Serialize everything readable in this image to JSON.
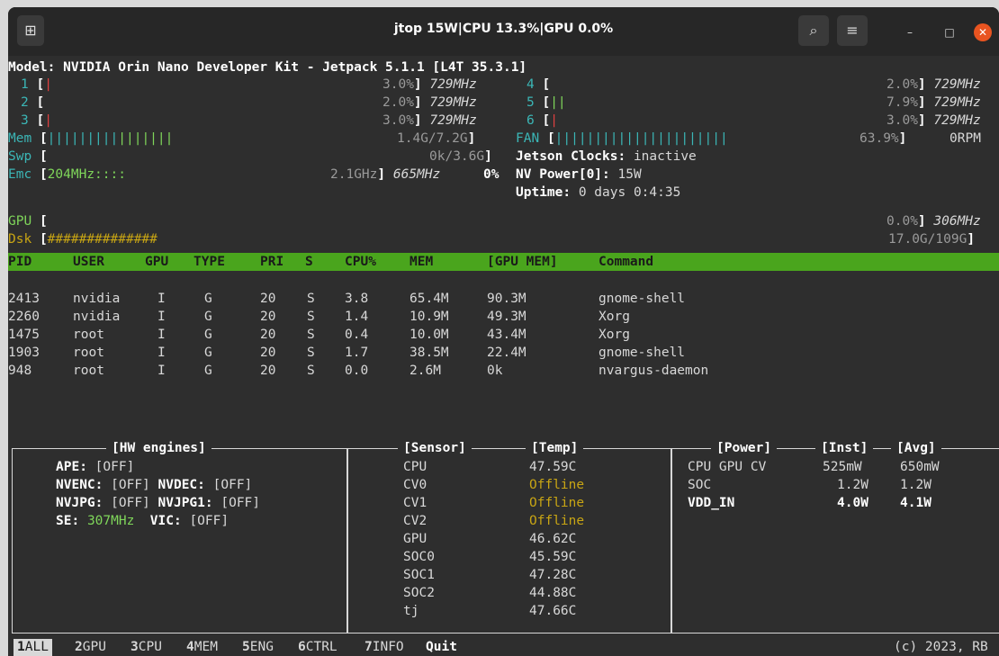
{
  "window": {
    "title": "jtop 15W|CPU 13.3%|GPU 0.0%"
  },
  "jtop": {
    "model": "Model: NVIDIA Orin Nano Developer Kit - Jetpack 5.1.1 [L4T 35.3.1]"
  },
  "cpus": [
    {
      "id": "1",
      "pct": "3.0%",
      "freq": "729MHz"
    },
    {
      "id": "2",
      "pct": "2.0%",
      "freq": "729MHz"
    },
    {
      "id": "3",
      "pct": "3.0%",
      "freq": "729MHz"
    },
    {
      "id": "4",
      "pct": "2.0%",
      "freq": "729MHz"
    },
    {
      "id": "5",
      "pct": "7.9%",
      "freq": "729MHz"
    },
    {
      "id": "6",
      "pct": "3.0%",
      "freq": "729MHz"
    }
  ],
  "mem": {
    "label": "Mem",
    "value": "1.4G/7.2G"
  },
  "fan": {
    "label": "FAN",
    "pct": "63.9%",
    "rpm": "0RPM"
  },
  "swap": {
    "label": "Swp",
    "value": "0k/3.6G"
  },
  "jetson_clocks": {
    "label": "Jetson Clocks:",
    "value": "inactive"
  },
  "emc": {
    "label": "Emc",
    "bar": "204MHz::::",
    "max": "2.1GHz",
    "freq": "665MHz",
    "pct": "0%"
  },
  "nvpower": {
    "label": "NV Power[0]:",
    "value": "15W"
  },
  "uptime": {
    "label": "Uptime:",
    "value": "0 days 0:4:35"
  },
  "gpu": {
    "label": "GPU",
    "pct": "0.0%",
    "freq": "306MHz"
  },
  "disk": {
    "label": "Dsk",
    "bar": "##############",
    "value": "17.0G/109G"
  },
  "proc": {
    "headers": [
      "PID",
      "USER",
      "GPU",
      "TYPE",
      "PRI",
      "S",
      "CPU%",
      "MEM",
      "[GPU MEM]",
      "Command"
    ],
    "rows": [
      [
        "2413",
        "nvidia",
        "I",
        "G",
        "20",
        "S",
        "3.8",
        "65.4M",
        "90.3M",
        "gnome-shell"
      ],
      [
        "2260",
        "nvidia",
        "I",
        "G",
        "20",
        "S",
        "1.4",
        "10.9M",
        "49.3M",
        "Xorg"
      ],
      [
        "1475",
        "root",
        "I",
        "G",
        "20",
        "S",
        "0.4",
        "10.0M",
        "43.4M",
        "Xorg"
      ],
      [
        "1903",
        "root",
        "I",
        "G",
        "20",
        "S",
        "1.7",
        "38.5M",
        "22.4M",
        "gnome-shell"
      ],
      [
        "948",
        "root",
        "I",
        "G",
        "20",
        "S",
        "0.0",
        "2.6M",
        "0k",
        "nvargus-daemon"
      ]
    ]
  },
  "hw": {
    "title": "[HW engines]",
    "ape_label": "APE:",
    "ape_value": "[OFF]",
    "nvenc_label": "NVENC:",
    "nvenc_value": "[OFF]",
    "nvdec_label": "NVDEC:",
    "nvdec_value": "[OFF]",
    "nvjpg_label": "NVJPG:",
    "nvjpg_value": "[OFF]",
    "nvjpg1_label": "NVJPG1:",
    "nvjpg1_value": "[OFF]",
    "se_label": "SE:",
    "se_value": "307MHz",
    "vic_label": "VIC:",
    "vic_value": "[OFF]"
  },
  "sensors": {
    "title": "[Sensor]",
    "temp_title": "[Temp]",
    "rows": [
      {
        "name": "CPU",
        "temp": "47.59C"
      },
      {
        "name": "CV0",
        "temp": "Offline"
      },
      {
        "name": "CV1",
        "temp": "Offline"
      },
      {
        "name": "CV2",
        "temp": "Offline"
      },
      {
        "name": "GPU",
        "temp": "46.62C"
      },
      {
        "name": "SOC0",
        "temp": "45.59C"
      },
      {
        "name": "SOC1",
        "temp": "47.28C"
      },
      {
        "name": "SOC2",
        "temp": "44.88C"
      },
      {
        "name": "tj",
        "temp": "47.66C"
      }
    ]
  },
  "power": {
    "title": "[Power]",
    "inst_title": "[Inst]",
    "avg_title": "[Avg]",
    "rows": [
      {
        "name": "CPU GPU CV",
        "inst": "525mW",
        "avg": "650mW"
      },
      {
        "name": "SOC",
        "inst": "1.2W",
        "avg": "1.2W"
      },
      {
        "name": "VDD_IN",
        "inst": "4.0W",
        "avg": "4.1W"
      }
    ]
  },
  "footer": [
    {
      "k": "1",
      "l": "ALL"
    },
    {
      "k": "2",
      "l": "GPU"
    },
    {
      "k": "3",
      "l": "CPU"
    },
    {
      "k": "4",
      "l": "MEM"
    },
    {
      "k": "5",
      "l": "ENG"
    },
    {
      "k": "6",
      "l": "CTRL"
    },
    {
      "k": "7",
      "l": "INFO"
    }
  ],
  "footer_quit": "Quit",
  "copyright": "(c) 2023, RB"
}
